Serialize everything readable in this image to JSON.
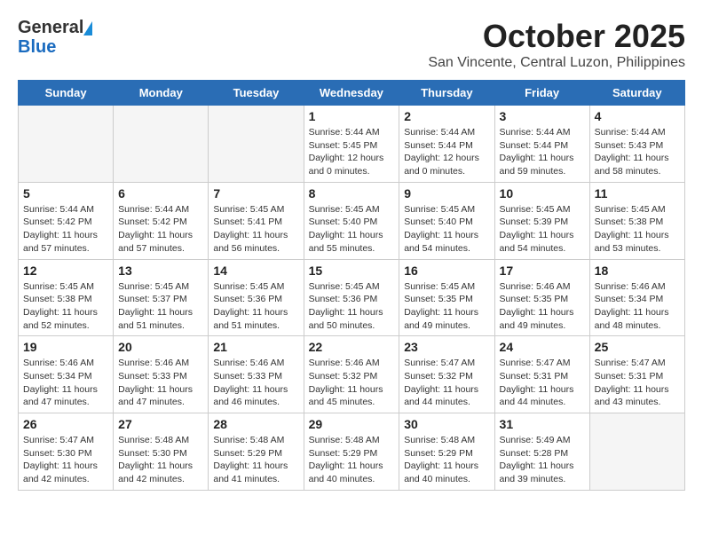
{
  "header": {
    "logo_general": "General",
    "logo_blue": "Blue",
    "month_title": "October 2025",
    "location": "San Vincente, Central Luzon, Philippines"
  },
  "calendar": {
    "days_of_week": [
      "Sunday",
      "Monday",
      "Tuesday",
      "Wednesday",
      "Thursday",
      "Friday",
      "Saturday"
    ],
    "weeks": [
      [
        {
          "day": "",
          "info": ""
        },
        {
          "day": "",
          "info": ""
        },
        {
          "day": "",
          "info": ""
        },
        {
          "day": "1",
          "info": "Sunrise: 5:44 AM\nSunset: 5:45 PM\nDaylight: 12 hours\nand 0 minutes."
        },
        {
          "day": "2",
          "info": "Sunrise: 5:44 AM\nSunset: 5:44 PM\nDaylight: 12 hours\nand 0 minutes."
        },
        {
          "day": "3",
          "info": "Sunrise: 5:44 AM\nSunset: 5:44 PM\nDaylight: 11 hours\nand 59 minutes."
        },
        {
          "day": "4",
          "info": "Sunrise: 5:44 AM\nSunset: 5:43 PM\nDaylight: 11 hours\nand 58 minutes."
        }
      ],
      [
        {
          "day": "5",
          "info": "Sunrise: 5:44 AM\nSunset: 5:42 PM\nDaylight: 11 hours\nand 57 minutes."
        },
        {
          "day": "6",
          "info": "Sunrise: 5:44 AM\nSunset: 5:42 PM\nDaylight: 11 hours\nand 57 minutes."
        },
        {
          "day": "7",
          "info": "Sunrise: 5:45 AM\nSunset: 5:41 PM\nDaylight: 11 hours\nand 56 minutes."
        },
        {
          "day": "8",
          "info": "Sunrise: 5:45 AM\nSunset: 5:40 PM\nDaylight: 11 hours\nand 55 minutes."
        },
        {
          "day": "9",
          "info": "Sunrise: 5:45 AM\nSunset: 5:40 PM\nDaylight: 11 hours\nand 54 minutes."
        },
        {
          "day": "10",
          "info": "Sunrise: 5:45 AM\nSunset: 5:39 PM\nDaylight: 11 hours\nand 54 minutes."
        },
        {
          "day": "11",
          "info": "Sunrise: 5:45 AM\nSunset: 5:38 PM\nDaylight: 11 hours\nand 53 minutes."
        }
      ],
      [
        {
          "day": "12",
          "info": "Sunrise: 5:45 AM\nSunset: 5:38 PM\nDaylight: 11 hours\nand 52 minutes."
        },
        {
          "day": "13",
          "info": "Sunrise: 5:45 AM\nSunset: 5:37 PM\nDaylight: 11 hours\nand 51 minutes."
        },
        {
          "day": "14",
          "info": "Sunrise: 5:45 AM\nSunset: 5:36 PM\nDaylight: 11 hours\nand 51 minutes."
        },
        {
          "day": "15",
          "info": "Sunrise: 5:45 AM\nSunset: 5:36 PM\nDaylight: 11 hours\nand 50 minutes."
        },
        {
          "day": "16",
          "info": "Sunrise: 5:45 AM\nSunset: 5:35 PM\nDaylight: 11 hours\nand 49 minutes."
        },
        {
          "day": "17",
          "info": "Sunrise: 5:46 AM\nSunset: 5:35 PM\nDaylight: 11 hours\nand 49 minutes."
        },
        {
          "day": "18",
          "info": "Sunrise: 5:46 AM\nSunset: 5:34 PM\nDaylight: 11 hours\nand 48 minutes."
        }
      ],
      [
        {
          "day": "19",
          "info": "Sunrise: 5:46 AM\nSunset: 5:34 PM\nDaylight: 11 hours\nand 47 minutes."
        },
        {
          "day": "20",
          "info": "Sunrise: 5:46 AM\nSunset: 5:33 PM\nDaylight: 11 hours\nand 47 minutes."
        },
        {
          "day": "21",
          "info": "Sunrise: 5:46 AM\nSunset: 5:33 PM\nDaylight: 11 hours\nand 46 minutes."
        },
        {
          "day": "22",
          "info": "Sunrise: 5:46 AM\nSunset: 5:32 PM\nDaylight: 11 hours\nand 45 minutes."
        },
        {
          "day": "23",
          "info": "Sunrise: 5:47 AM\nSunset: 5:32 PM\nDaylight: 11 hours\nand 44 minutes."
        },
        {
          "day": "24",
          "info": "Sunrise: 5:47 AM\nSunset: 5:31 PM\nDaylight: 11 hours\nand 44 minutes."
        },
        {
          "day": "25",
          "info": "Sunrise: 5:47 AM\nSunset: 5:31 PM\nDaylight: 11 hours\nand 43 minutes."
        }
      ],
      [
        {
          "day": "26",
          "info": "Sunrise: 5:47 AM\nSunset: 5:30 PM\nDaylight: 11 hours\nand 42 minutes."
        },
        {
          "day": "27",
          "info": "Sunrise: 5:48 AM\nSunset: 5:30 PM\nDaylight: 11 hours\nand 42 minutes."
        },
        {
          "day": "28",
          "info": "Sunrise: 5:48 AM\nSunset: 5:29 PM\nDaylight: 11 hours\nand 41 minutes."
        },
        {
          "day": "29",
          "info": "Sunrise: 5:48 AM\nSunset: 5:29 PM\nDaylight: 11 hours\nand 40 minutes."
        },
        {
          "day": "30",
          "info": "Sunrise: 5:48 AM\nSunset: 5:29 PM\nDaylight: 11 hours\nand 40 minutes."
        },
        {
          "day": "31",
          "info": "Sunrise: 5:49 AM\nSunset: 5:28 PM\nDaylight: 11 hours\nand 39 minutes."
        },
        {
          "day": "",
          "info": ""
        }
      ]
    ]
  }
}
